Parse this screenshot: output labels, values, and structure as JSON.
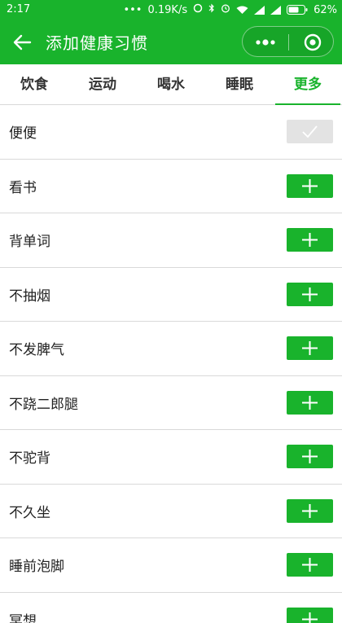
{
  "status_bar": {
    "time": "2:17",
    "network_speed": "0.19K/s",
    "battery": "62%"
  },
  "header": {
    "title": "添加健康习惯",
    "back_icon": "arrow-left-icon",
    "more_icon": "more-dots-icon",
    "close_icon": "target-circle-icon"
  },
  "tabs": [
    {
      "label": "饮食",
      "active": false
    },
    {
      "label": "运动",
      "active": false
    },
    {
      "label": "喝水",
      "active": false
    },
    {
      "label": "睡眠",
      "active": false
    },
    {
      "label": "更多",
      "active": true
    }
  ],
  "habits": [
    {
      "label": "便便",
      "added": true
    },
    {
      "label": "看书",
      "added": false
    },
    {
      "label": "背单词",
      "added": false
    },
    {
      "label": "不抽烟",
      "added": false
    },
    {
      "label": "不发脾气",
      "added": false
    },
    {
      "label": "不跷二郎腿",
      "added": false
    },
    {
      "label": "不驼背",
      "added": false
    },
    {
      "label": "不久坐",
      "added": false
    },
    {
      "label": "睡前泡脚",
      "added": false
    },
    {
      "label": "冥想",
      "added": false
    }
  ],
  "colors": {
    "accent": "#19b32c",
    "added_button": "#e3e3e3"
  }
}
